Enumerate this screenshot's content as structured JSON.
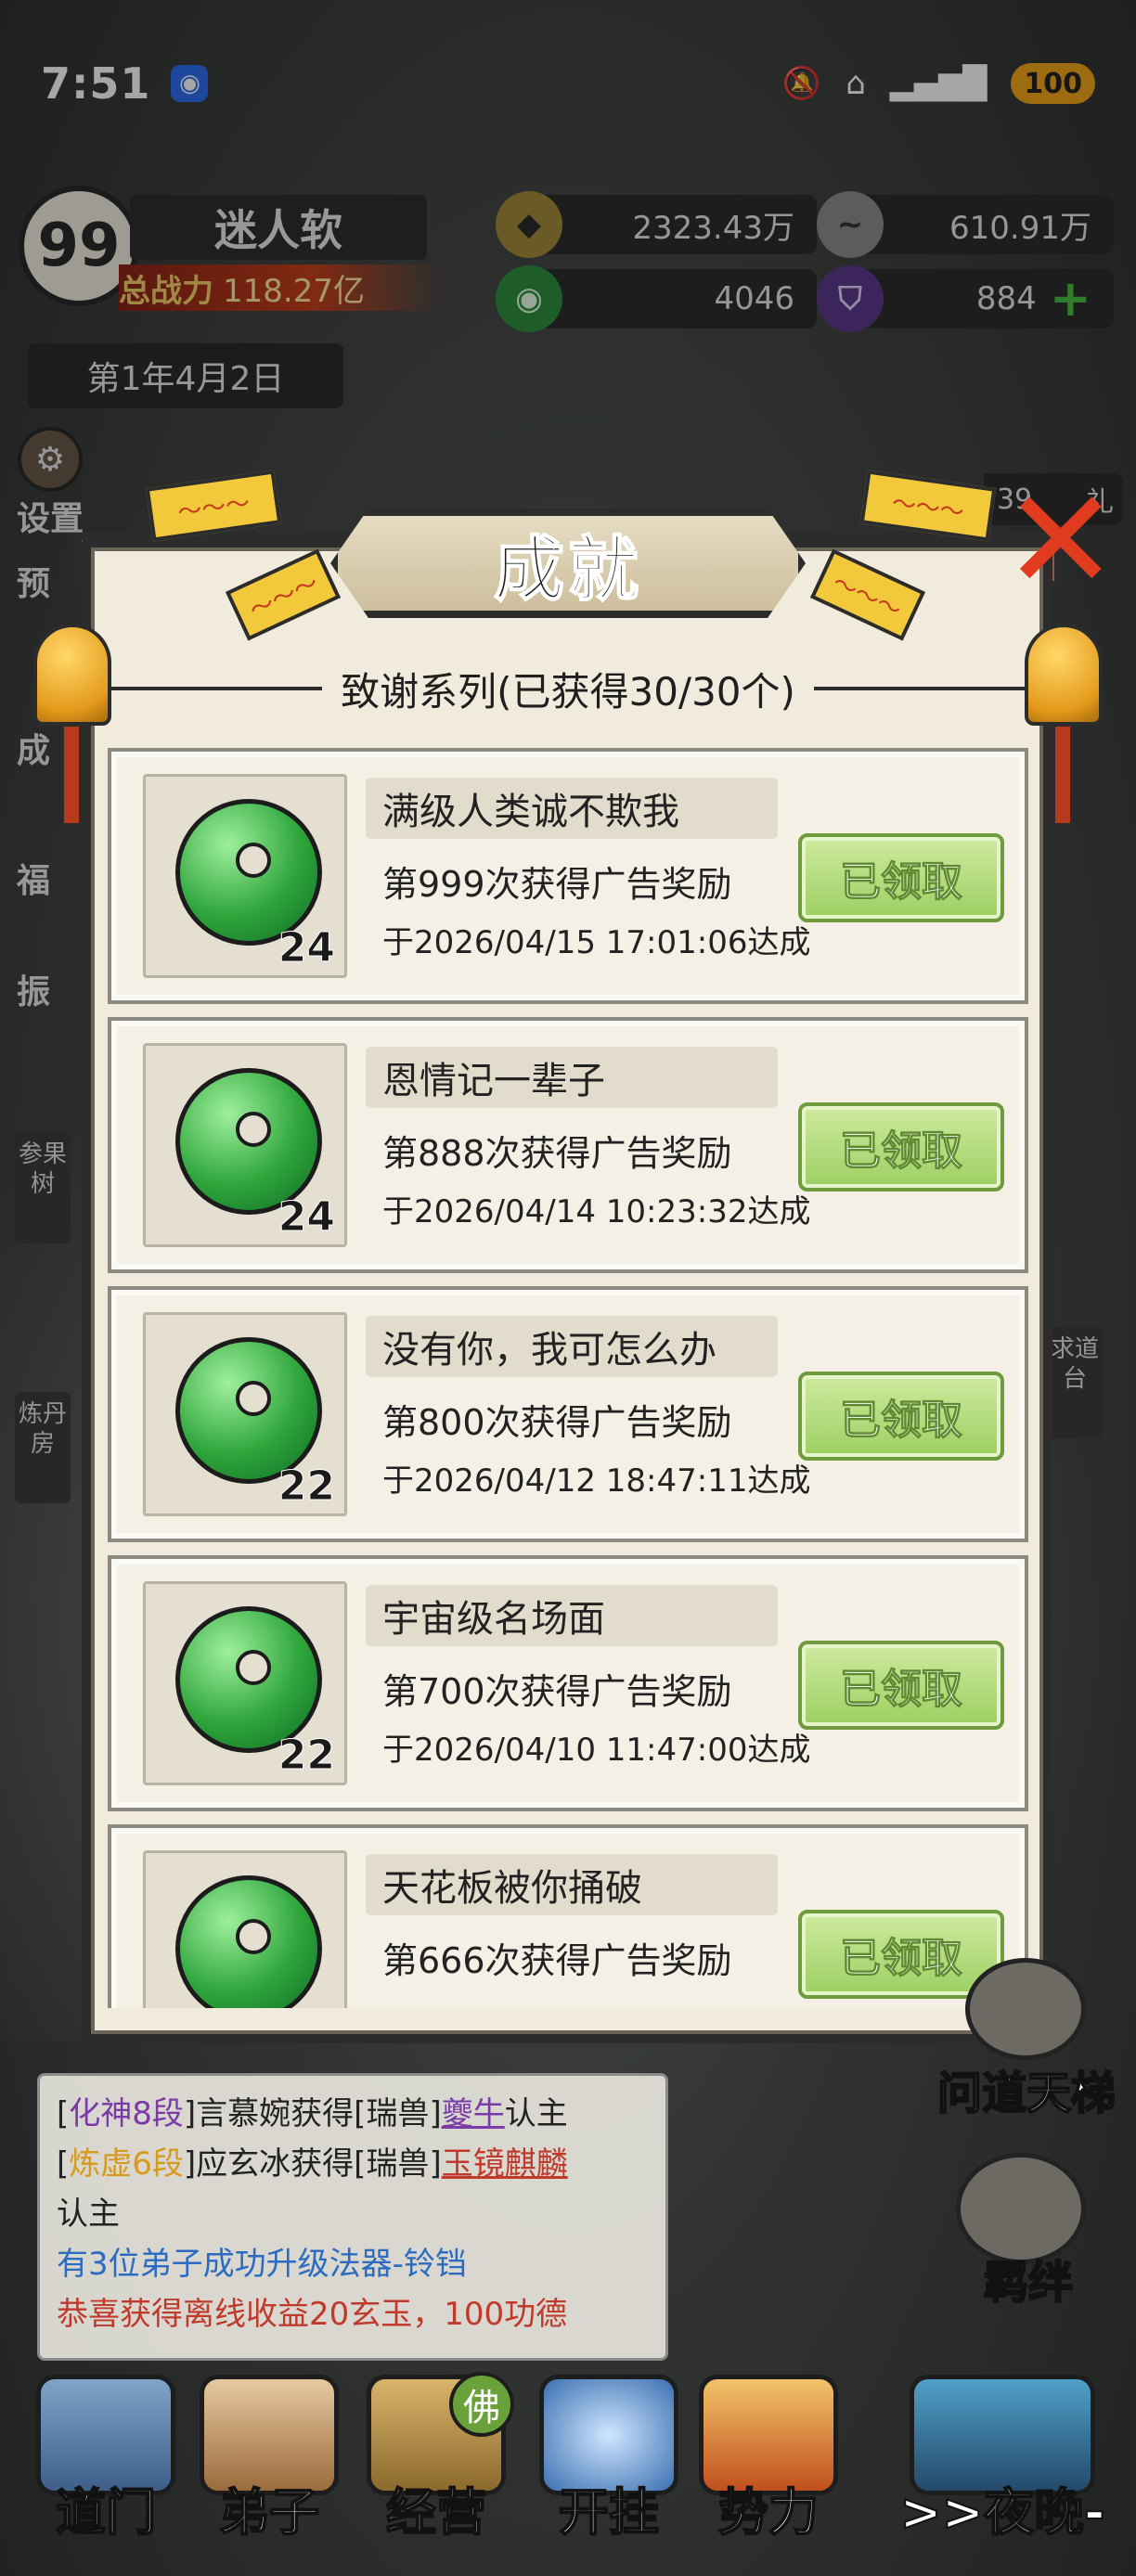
{
  "status_bar": {
    "time": "7:51",
    "battery": "100"
  },
  "player": {
    "avatar_text": "99",
    "name": "迷人软",
    "power_label": "总战力",
    "power_value": "118.27亿",
    "date": "第1年4月2日"
  },
  "resources": {
    "coin": "2323.43万",
    "wind": "610.91万",
    "jade": "4046",
    "shield": "884"
  },
  "side_menu": {
    "settings": "设置",
    "gift_badge": "39",
    "gift_label": "礼",
    "partial_1": "预",
    "partial_2": "成",
    "partial_3": "福",
    "partial_4": "振",
    "cangguo": "参果树",
    "liandan": "炼丹房",
    "qiudao": "求道台"
  },
  "modal": {
    "title": "成就",
    "series": "致谢系列(已获得30/30个)",
    "ribbon_text": "～～～",
    "claim_label": "已领取",
    "items": [
      {
        "title": "满级人类诚不欺我",
        "desc": "第999次获得广告奖励",
        "date": "于2026/04/15 17:01:06达成",
        "count": "24"
      },
      {
        "title": "恩情记一辈子",
        "desc": "第888次获得广告奖励",
        "date": "于2026/04/14 10:23:32达成",
        "count": "24"
      },
      {
        "title": "没有你，我可怎么办",
        "desc": "第800次获得广告奖励",
        "date": "于2026/04/12 18:47:11达成",
        "count": "22"
      },
      {
        "title": "宇宙级名场面",
        "desc": "第700次获得广告奖励",
        "date": "于2026/04/10 11:47:00达成",
        "count": "22"
      },
      {
        "title": "天花板被你捅破",
        "desc": "第666次获得广告奖励",
        "date": "",
        "count": ""
      }
    ]
  },
  "log": {
    "l1_a": "[",
    "l1_rank": "化神8段",
    "l1_b": "]言慕婉获得[",
    "l1_type": "瑞兽",
    "l1_c": "]",
    "l1_beast": "夔牛",
    "l1_d": "认主",
    "l2_a": "[",
    "l2_rank": "炼虚6段",
    "l2_b": "]应玄冰获得[",
    "l2_type": "瑞兽",
    "l2_c": "]",
    "l2_beast": "玉镜麒麟",
    "l2_d": "认主",
    "l3": "有3位弟子成功升级法器-铃铛",
    "l4": "恭喜获得离线收益20玄玉，100功德"
  },
  "right_bottom": {
    "wendao": "问道天梯",
    "jiban": "羁绊"
  },
  "nav": {
    "daomen": "道门",
    "dizi": "弟子",
    "jingying": "经营",
    "fo_badge": "佛",
    "kaigua": "开挂",
    "shili": "势力",
    "yewan": ">>夜晚-"
  }
}
